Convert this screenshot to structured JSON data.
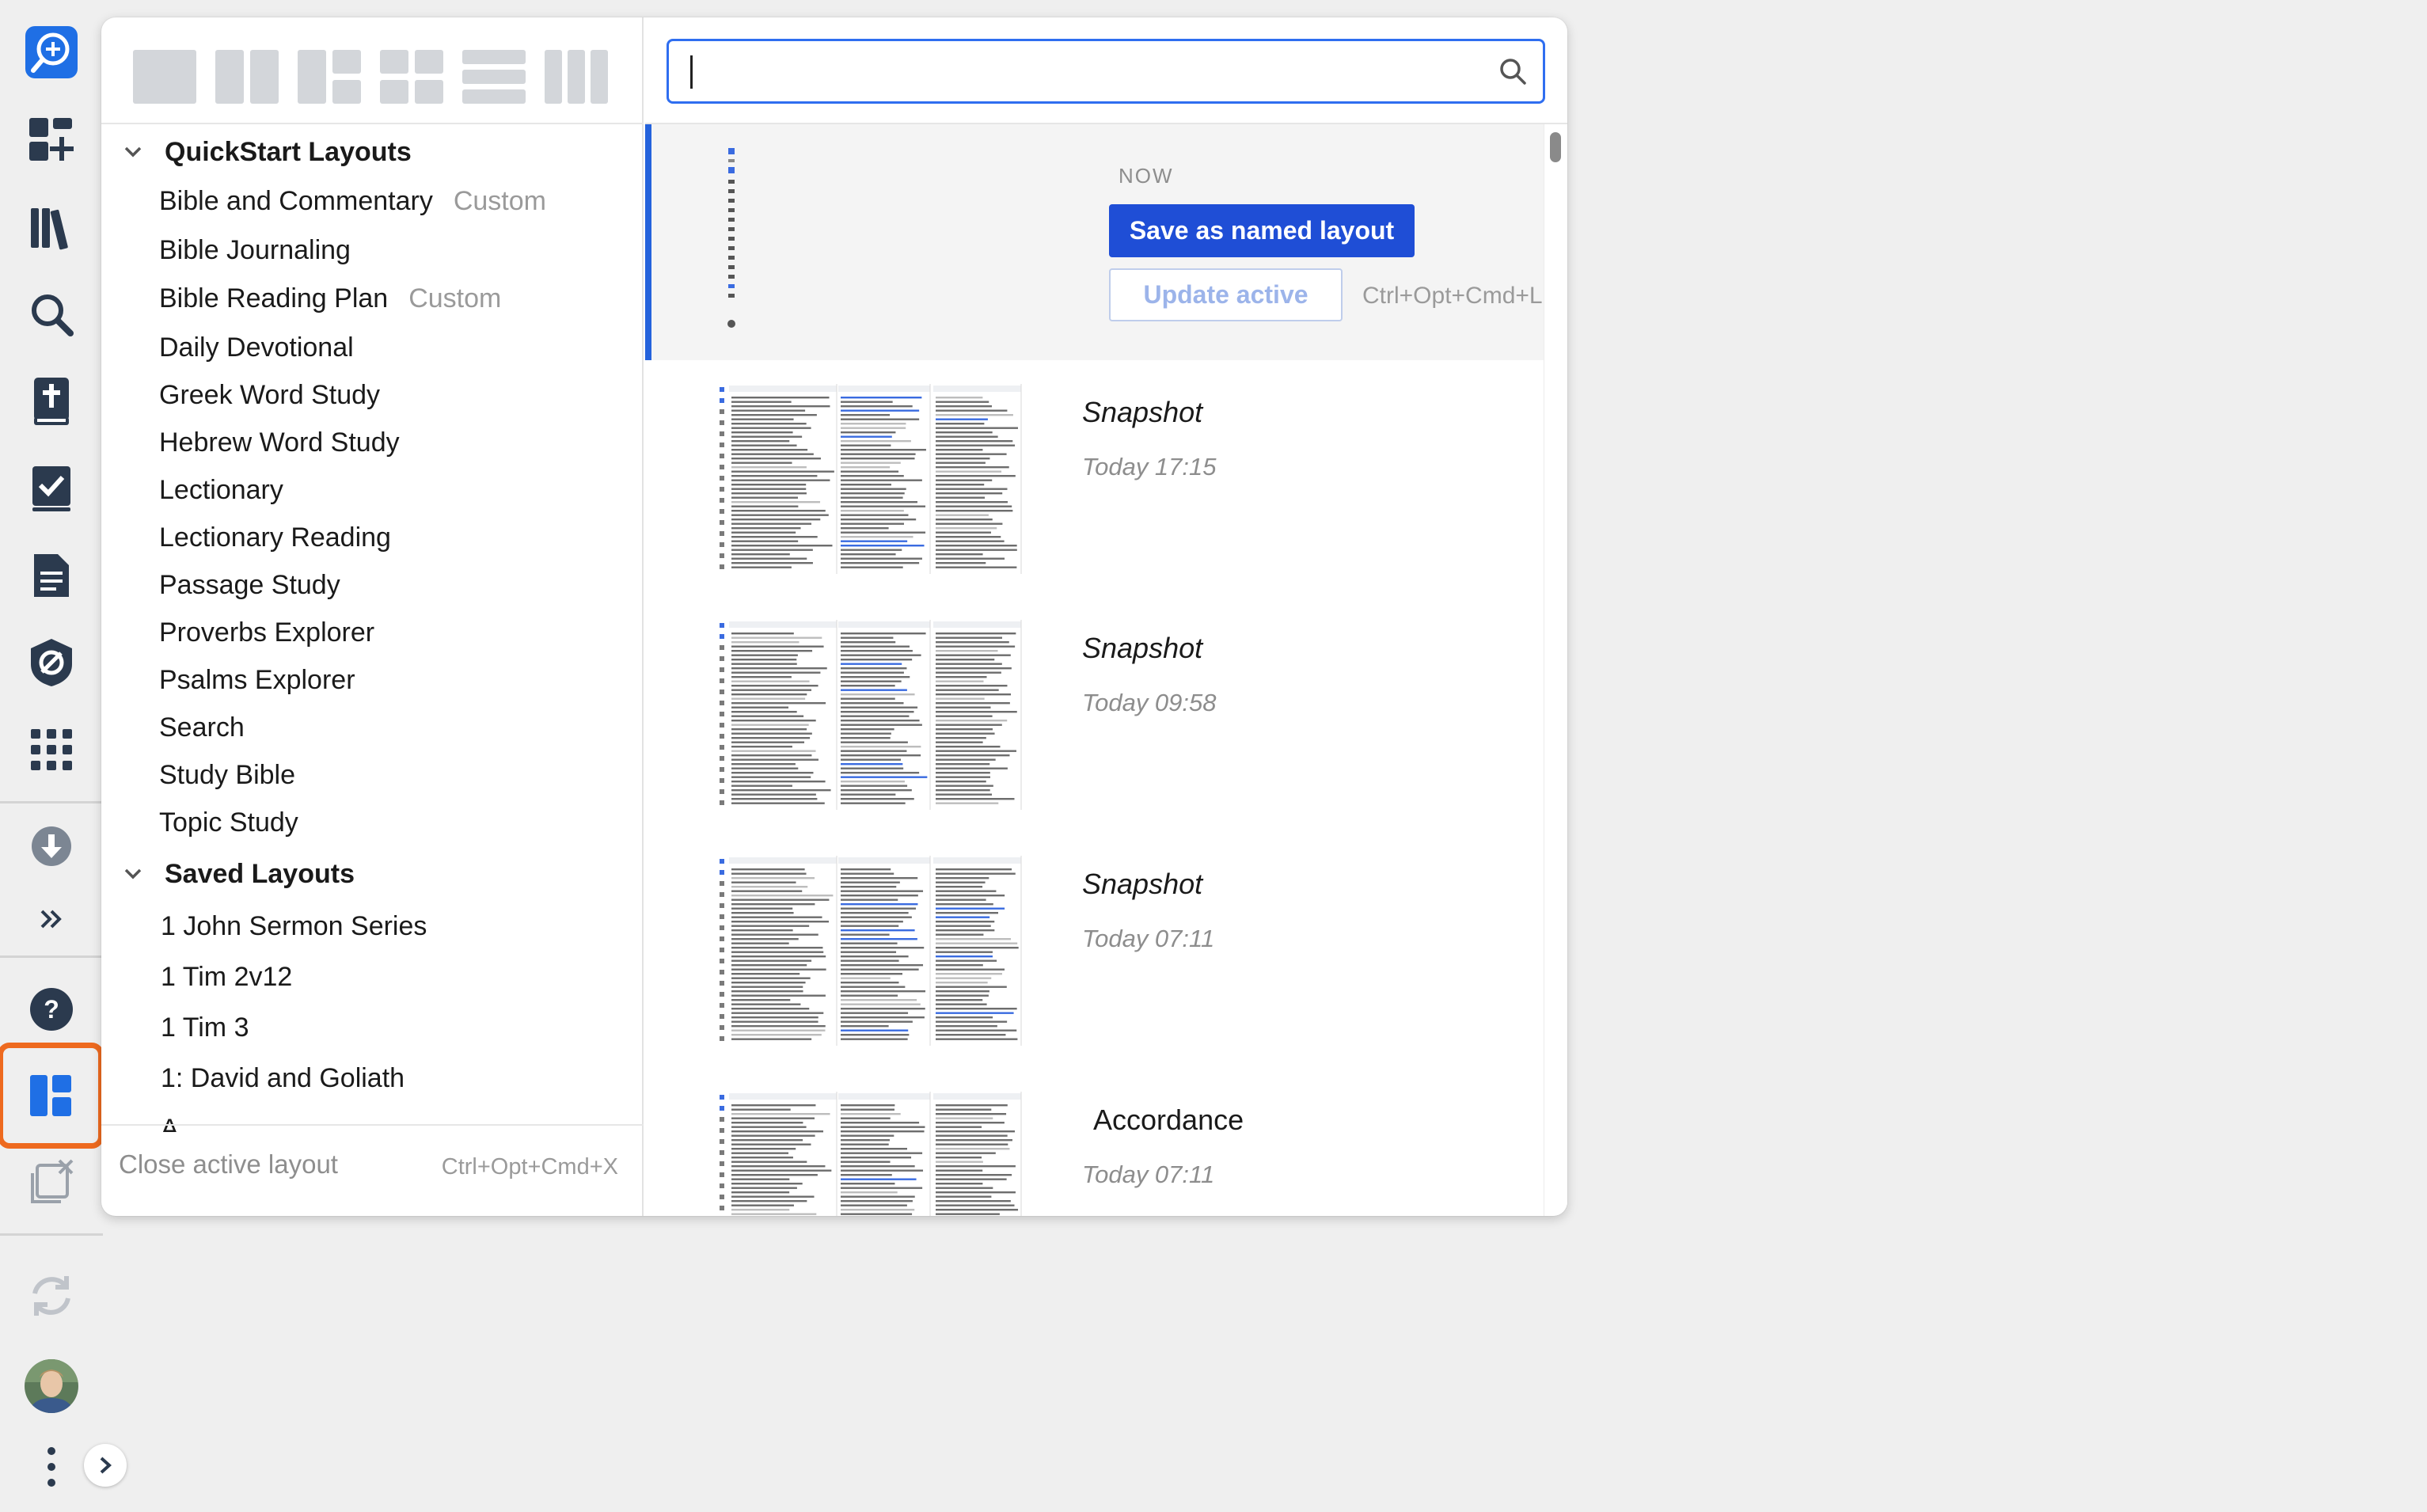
{
  "rail": {
    "items": [
      {
        "name": "shortcuts-icon"
      },
      {
        "name": "add-panel-icon"
      },
      {
        "name": "library-icon"
      },
      {
        "name": "search-icon"
      },
      {
        "name": "bible-icon"
      },
      {
        "name": "checklist-icon"
      },
      {
        "name": "document-icon"
      },
      {
        "name": "no-tracking-icon"
      },
      {
        "name": "apps-grid-icon"
      },
      {
        "name": "download-icon"
      },
      {
        "name": "more-chevron-icon"
      },
      {
        "name": "help-icon"
      },
      {
        "name": "layouts-icon"
      },
      {
        "name": "close-panels-icon"
      },
      {
        "name": "sync-icon"
      },
      {
        "name": "avatar"
      },
      {
        "name": "kebab-menu-icon"
      },
      {
        "name": "expand-rail-icon"
      }
    ],
    "active": "layouts-icon",
    "accent": "#ee6a1f"
  },
  "panel": {
    "layout_types": [
      "single-panel-icon",
      "two-columns-icon",
      "three-mixed-icon",
      "four-grid-icon",
      "three-rows-icon",
      "three-columns-icon"
    ],
    "quickstart": {
      "heading": "QuickStart Layouts",
      "items": [
        {
          "label": "Bible and Commentary",
          "tag": "Custom"
        },
        {
          "label": "Bible Journaling",
          "tag": ""
        },
        {
          "label": "Bible Reading Plan",
          "tag": "Custom"
        },
        {
          "label": "Daily Devotional",
          "tag": ""
        },
        {
          "label": "Greek Word Study",
          "tag": ""
        },
        {
          "label": "Hebrew Word Study",
          "tag": ""
        },
        {
          "label": "Lectionary",
          "tag": ""
        },
        {
          "label": "Lectionary Reading",
          "tag": ""
        },
        {
          "label": "Passage Study",
          "tag": ""
        },
        {
          "label": "Proverbs Explorer",
          "tag": ""
        },
        {
          "label": "Psalms Explorer",
          "tag": ""
        },
        {
          "label": "Search",
          "tag": ""
        },
        {
          "label": "Study Bible",
          "tag": ""
        },
        {
          "label": "Topic Study",
          "tag": ""
        }
      ]
    },
    "saved": {
      "heading": "Saved Layouts",
      "items": [
        {
          "label": "1 John Sermon Series"
        },
        {
          "label": "1 Tim 2v12"
        },
        {
          "label": "1 Tim 3"
        },
        {
          "label": "1: David and Goliath"
        },
        {
          "label": "A"
        }
      ]
    },
    "footer": {
      "close_label": "Close active layout",
      "close_shortcut": "Ctrl+Opt+Cmd+X"
    },
    "search": {
      "value": "",
      "placeholder": ""
    },
    "now": {
      "label": "NOW",
      "save_label": "Save as named layout",
      "update_label": "Update active",
      "update_shortcut": "Ctrl+Opt+Cmd+L"
    },
    "snapshots": [
      {
        "title": "Snapshot",
        "time": "Today 17:15"
      },
      {
        "title": "Snapshot",
        "time": "Today 09:58"
      },
      {
        "title": "Snapshot",
        "time": "Today 07:11"
      },
      {
        "title": "Accordance",
        "time": "Today 07:11"
      }
    ]
  },
  "colors": {
    "primary": "#1f4ed6",
    "focus": "#2f6ef0",
    "active_outline": "#ee6a1f",
    "rail_icon": "#2b3a4e"
  }
}
